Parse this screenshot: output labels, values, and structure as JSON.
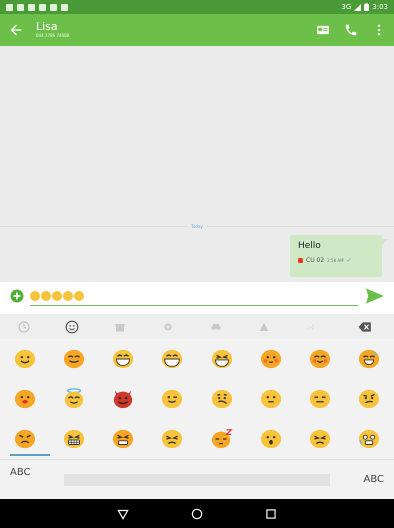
{
  "status_bar": {
    "network": "3G",
    "time": "3:03"
  },
  "app_bar": {
    "contact_name": "Lisa",
    "contact_number": "044 3786 74608",
    "back_icon": "arrow-left-icon",
    "contact_card_icon": "contact-card-icon",
    "call_icon": "phone-icon",
    "menu_icon": "overflow-menu-icon"
  },
  "conversation": {
    "date_divider": "Today",
    "messages": [
      {
        "text": "Hello",
        "sim": "CU 02",
        "time": "2:58 AM",
        "status": "sent"
      }
    ]
  },
  "compose": {
    "add_icon": "add-circle-icon",
    "send_icon": "send-icon",
    "draft_emoji_count": 5
  },
  "emoji_keyboard": {
    "tabs": [
      "recent",
      "smileys",
      "objects",
      "nature",
      "places",
      "symbols",
      "emoticons"
    ],
    "active_tab": "smileys",
    "delete_icon": "backspace-icon",
    "abc_left": "ABC",
    "abc_right": "ABC"
  },
  "colors": {
    "app_bar": "#6cc04a",
    "status_bar": "#4a9a38",
    "bubble": "#cfe8c5",
    "accent": "#6cc04a"
  }
}
